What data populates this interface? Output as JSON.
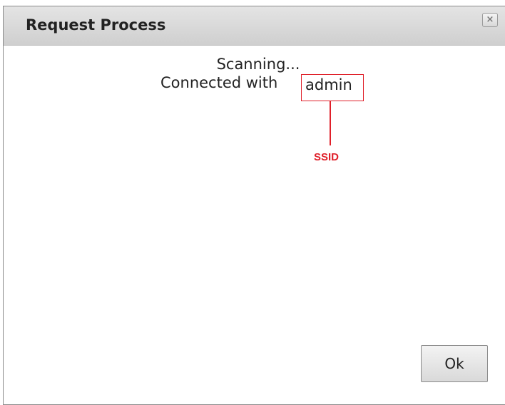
{
  "dialog": {
    "title": "Request Process",
    "close_icon": "close-icon",
    "close_glyph": "×"
  },
  "content": {
    "status_text": "Scanning...",
    "connected_prefix": "Connected with",
    "ssid_value": "admin"
  },
  "annotation": {
    "label": "SSID",
    "color": "#e0202a"
  },
  "buttons": {
    "ok_label": "Ok"
  }
}
